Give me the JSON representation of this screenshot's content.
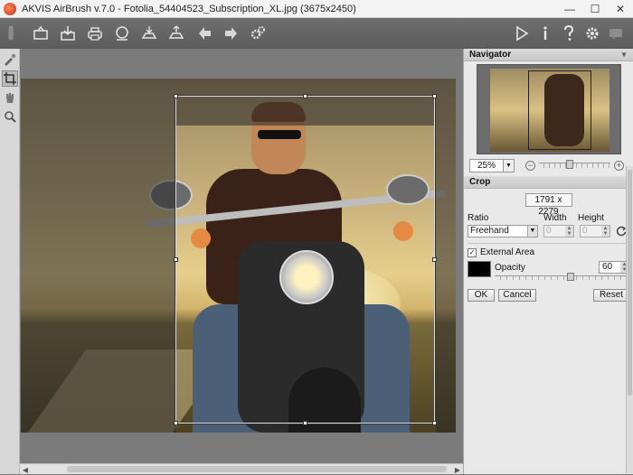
{
  "window": {
    "title": "AKVIS AirBrush v.7.0 - Fotolia_54404523_Subscription_XL.jpg (3675x2450)",
    "minimize": "—",
    "maximize": "☐",
    "close": "✕"
  },
  "toolbar": {
    "left_icons": [
      "bottle-icon",
      "open-icon",
      "save-icon",
      "print-icon",
      "share-icon",
      "batch-import-icon",
      "batch-export-icon",
      "undo-arrow-icon",
      "redo-arrow-icon",
      "settings-gears-icon"
    ],
    "right_icons": [
      "run-icon",
      "info-icon",
      "help-icon",
      "preferences-gear-icon",
      "notifications-icon"
    ]
  },
  "tools": [
    "airbrush-tool-icon",
    "crop-tool-icon",
    "hand-tool-icon",
    "zoom-tool-icon"
  ],
  "navigator": {
    "title": "Navigator",
    "zoom": "25%"
  },
  "crop": {
    "title": "Crop",
    "size": "1791 x 2279",
    "ratio_label": "Ratio",
    "width_label": "Width",
    "height_label": "Height",
    "ratio_value": "Freehand",
    "width_value": "0",
    "height_value": "0",
    "external_area_label": "External Area",
    "external_area_checked": "✓",
    "external_color": "#000000",
    "opacity_label": "Opacity",
    "opacity_value": "60",
    "ok_label": "OK",
    "cancel_label": "Cancel",
    "reset_label": "Reset"
  }
}
